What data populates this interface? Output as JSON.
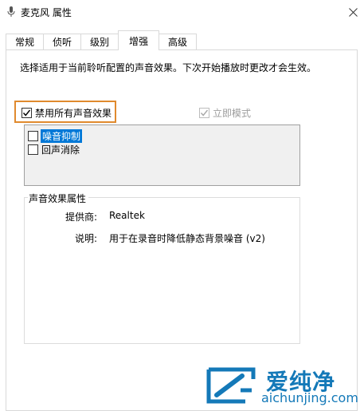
{
  "window": {
    "title": "麦克风 属性",
    "close_icon": "close-icon"
  },
  "tabs": [
    {
      "label": "常规",
      "active": false
    },
    {
      "label": "侦听",
      "active": false
    },
    {
      "label": "级别",
      "active": false
    },
    {
      "label": "增强",
      "active": true
    },
    {
      "label": "高级",
      "active": false
    }
  ],
  "enhancements": {
    "description": "选择适用于当前聆听配置的声音效果。下次开始播放时更改才会生效。",
    "disable_all": {
      "label": "禁用所有声音效果",
      "checked": true
    },
    "immediate_mode": {
      "label": "立即模式",
      "checked": true,
      "disabled": true
    },
    "effects": [
      {
        "label": "噪音抑制",
        "checked": false,
        "selected": true
      },
      {
        "label": "回声消除",
        "checked": false,
        "selected": false
      }
    ]
  },
  "properties": {
    "group_title": "声音效果属性",
    "provider_label": "提供商:",
    "provider_value": "Realtek",
    "desc_label": "说明:",
    "desc_value": "用于在录音时降低静态背景噪音 (v2)"
  },
  "watermark": {
    "name": "爱纯净",
    "url": "aichunjing.com"
  },
  "colors": {
    "accent_highlight_border": "#e08a2e",
    "selection_blue": "#0078d7",
    "watermark_blue": "#1479b8"
  }
}
